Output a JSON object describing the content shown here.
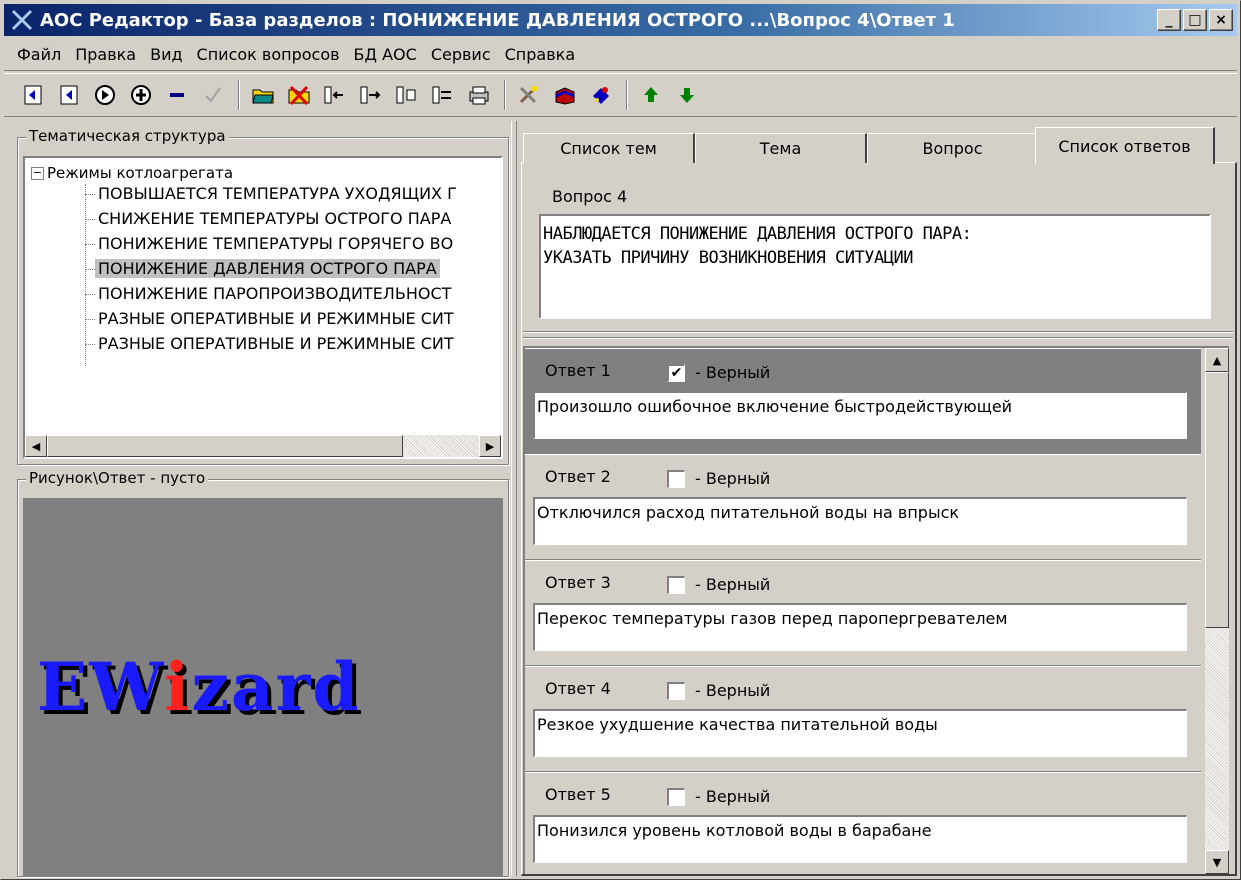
{
  "window": {
    "title": "АОС Редактор - База разделов : ПОНИЖЕНИЕ ДАВЛЕНИЯ ОСТРОГО ...\\Вопрос 4\\Ответ 1",
    "minimize": "_",
    "maximize": "□",
    "close": "×"
  },
  "menu": [
    "Файл",
    "Правка",
    "Вид",
    "Список вопросов",
    "БД АОС",
    "Сервис",
    "Справка"
  ],
  "toolbar": {
    "icons": [
      "nav-first-icon",
      "nav-prev-icon",
      "nav-next-icon",
      "nav-last-icon",
      "delete-icon",
      "apply-check-icon",
      "open-folder-icon",
      "delete-record-icon",
      "move-left-icon",
      "move-right-icon",
      "branch-icon",
      "merge-icon",
      "print-icon",
      "tools-icon",
      "book-icon",
      "stars-icon",
      "arrow-up-icon",
      "arrow-down-icon"
    ]
  },
  "tree_panel": {
    "label": "Тематическая структура",
    "root": "Режимы котлоагрегата",
    "items": [
      "ПОВЫШАЕТСЯ ТЕМПЕРАТУРА УХОДЯЩИХ Г",
      "СНИЖЕНИЕ ТЕМПЕРАТУРЫ ОСТРОГО ПАРА",
      "ПОНИЖЕНИЕ ТЕМПЕРАТУРЫ ГОРЯЧЕГО ВО",
      "ПОНИЖЕНИЕ ДАВЛЕНИЯ ОСТРОГО ПАРА",
      "ПОНИЖЕНИЕ ПАРОПРОИЗВОДИТЕЛЬНОСТ",
      "РАЗНЫЕ ОПЕРАТИВНЫЕ И РЕЖИМНЫЕ СИТ",
      "РАЗНЫЕ ОПЕРАТИВНЫЕ И РЕЖИМНЫЕ СИТ"
    ],
    "selected_index": 3
  },
  "picture_panel": {
    "label": "Рисунок\\Ответ  - пусто",
    "logo_text": "EWizard"
  },
  "tabs": [
    "Список тем",
    "Тема",
    "Вопрос",
    "Список ответов"
  ],
  "active_tab": 3,
  "question": {
    "label": "Вопрос 4",
    "line1": "НАБЛЮДАЕТСЯ ПОНИЖЕНИЕ ДАВЛЕНИЯ ОСТРОГО ПАРА:",
    "line2": "УКАЗАТЬ ПРИЧИНУ ВОЗНИКНОВЕНИЯ СИТУАЦИИ"
  },
  "answers": [
    {
      "label": "Ответ 1",
      "checked": true,
      "correct_label": "- Верный",
      "text": "Произошло ошибочное включение быстродействующей"
    },
    {
      "label": "Ответ 2",
      "checked": false,
      "correct_label": "- Верный",
      "text": "Отключился расход питательной воды на впрыск"
    },
    {
      "label": "Ответ 3",
      "checked": false,
      "correct_label": "- Верный",
      "text": "Перекос температуры газов перед паропергревателем"
    },
    {
      "label": "Ответ 4",
      "checked": false,
      "correct_label": "- Верный",
      "text": "Резкое ухудшение качества питательной воды"
    },
    {
      "label": "Ответ 5",
      "checked": false,
      "correct_label": "- Верный",
      "text": "Понизился уровень котловой воды в барабане"
    }
  ],
  "colors": {
    "title_gradient_start": "#0a246a",
    "window_face": "#d4d0c8",
    "selected_answer_bg": "#808080",
    "logo_blue": "#1a1aff",
    "logo_red": "#ff2020"
  }
}
